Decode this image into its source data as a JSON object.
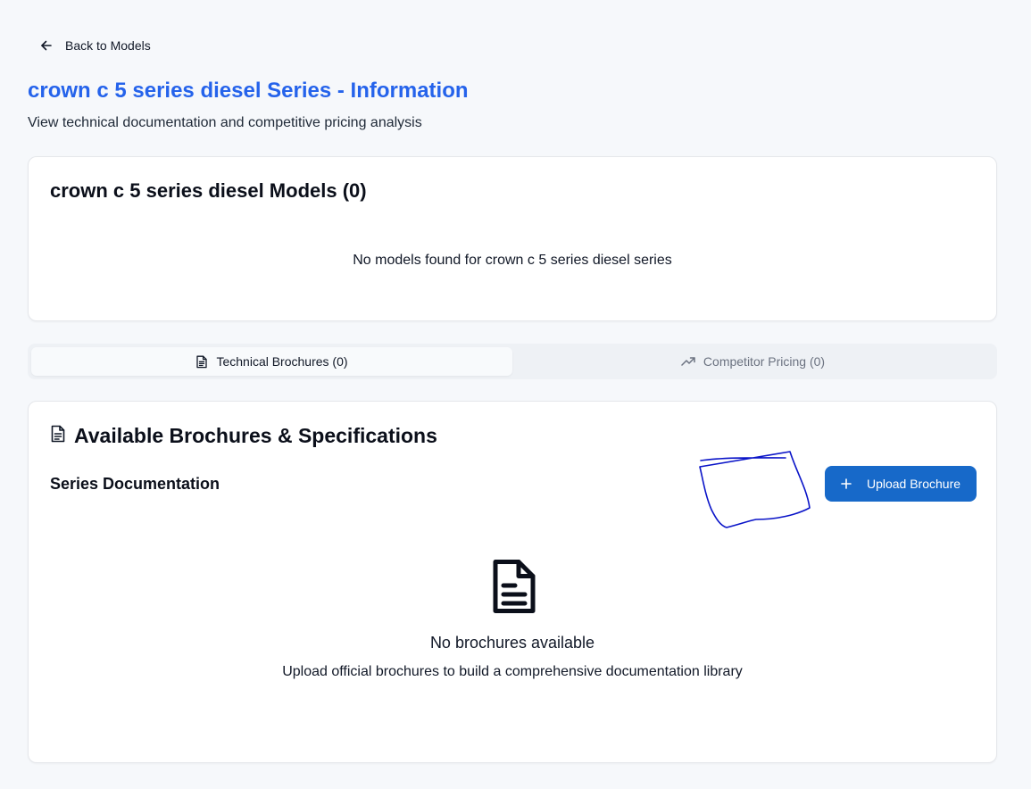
{
  "nav": {
    "back_label": "Back to Models",
    "back_icon": "arrow-left-icon"
  },
  "header": {
    "title": "crown c 5 series diesel Series - Information",
    "subtitle": "View technical documentation and competitive pricing analysis",
    "title_color": "#2563eb"
  },
  "models": {
    "title": "crown c 5 series diesel Models (0)",
    "empty_message": "No models found for crown c 5 series diesel series"
  },
  "tabs": [
    {
      "label": "Technical Brochures (0)",
      "icon": "file-text-icon",
      "active": true
    },
    {
      "label": "Competitor Pricing (0)",
      "icon": "trending-up-icon",
      "active": false
    }
  ],
  "brochures": {
    "title": "Available Brochures & Specifications",
    "title_icon": "file-text-icon",
    "section_label": "Series Documentation",
    "upload_label": "Upload Brochure",
    "upload_icon": "plus-icon",
    "upload_color": "#1769c9",
    "empty_icon": "file-text-icon",
    "empty_title": "No brochures available",
    "empty_description": "Upload official brochures to build a comprehensive documentation library"
  },
  "annotation": {
    "scribble_color": "#0a14c8"
  }
}
